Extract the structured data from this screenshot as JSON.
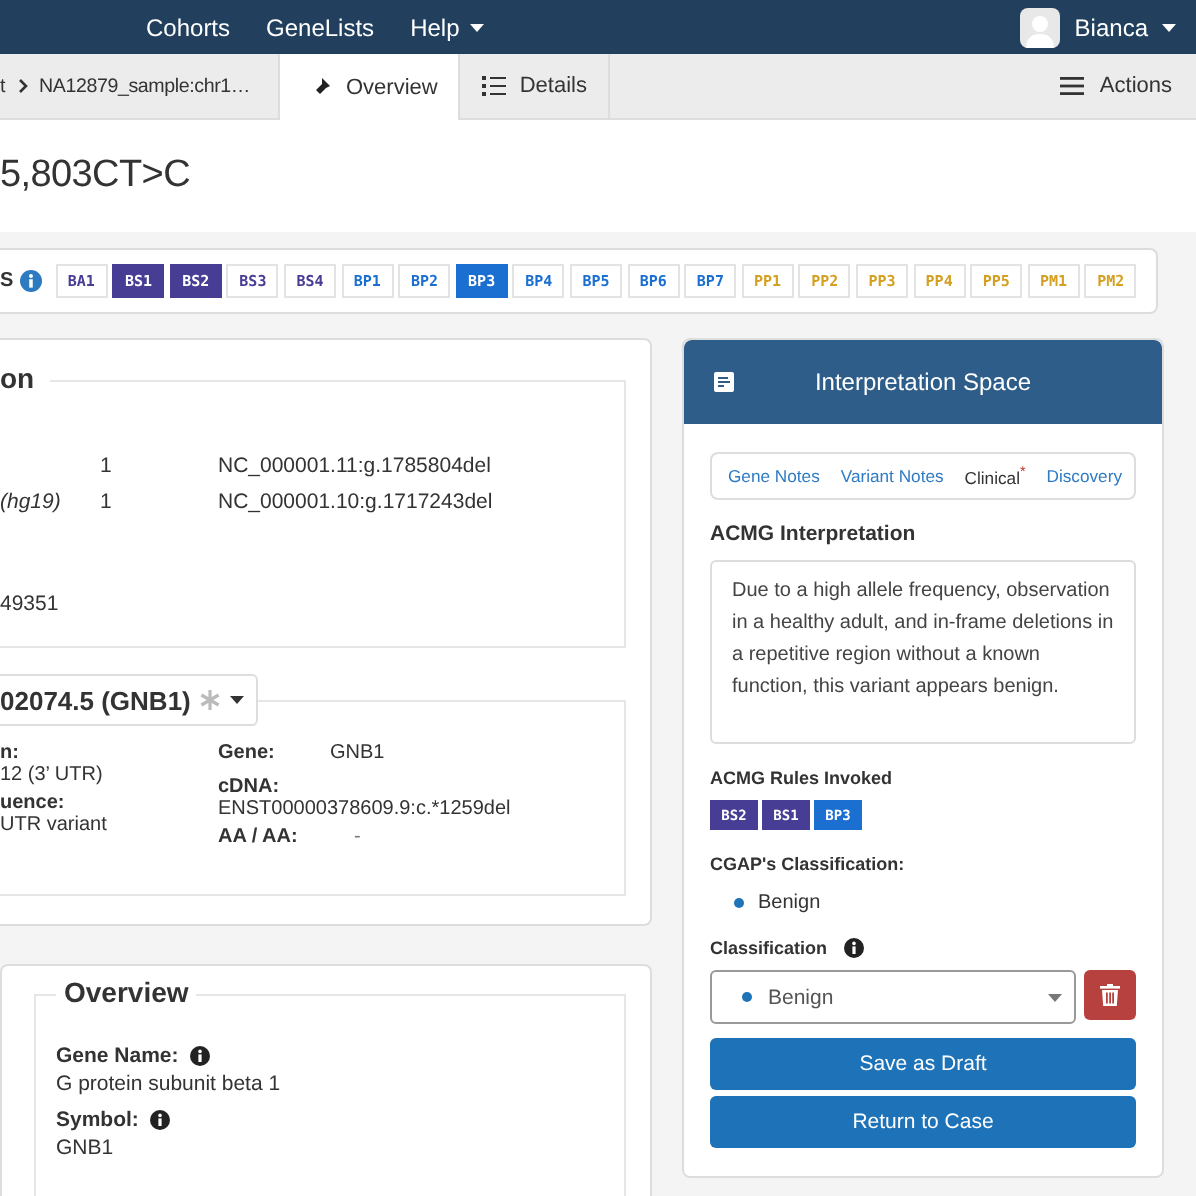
{
  "navbar": {
    "links": [
      {
        "label": "Cohorts",
        "dropdown": false
      },
      {
        "label": "GeneLists",
        "dropdown": false
      },
      {
        "label": "Help",
        "dropdown": true
      }
    ],
    "user": {
      "name": "Bianca",
      "dropdown": true
    }
  },
  "tabbar": {
    "breadcrumbs": [
      "t",
      "NA12879_sample:chr1…"
    ],
    "tabs": [
      {
        "label": "Overview",
        "selected": true
      },
      {
        "label": "Details",
        "selected": false
      }
    ],
    "actions": "Actions"
  },
  "title": "5,803CT>C",
  "acmg_rules": {
    "label": "S",
    "rules": [
      {
        "code": "BA1",
        "color": "#473d94",
        "selected": false
      },
      {
        "code": "BS1",
        "color": "#473d94",
        "selected": true
      },
      {
        "code": "BS2",
        "color": "#473d94",
        "selected": true
      },
      {
        "code": "BS3",
        "color": "#473d94",
        "selected": false
      },
      {
        "code": "BS4",
        "color": "#473d94",
        "selected": false
      },
      {
        "code": "BP1",
        "color": "#1a6fd0",
        "selected": false
      },
      {
        "code": "BP2",
        "color": "#1a6fd0",
        "selected": false
      },
      {
        "code": "BP3",
        "color": "#1a6fd0",
        "selected": true
      },
      {
        "code": "BP4",
        "color": "#1a6fd0",
        "selected": false
      },
      {
        "code": "BP5",
        "color": "#1a6fd0",
        "selected": false
      },
      {
        "code": "BP6",
        "color": "#1a6fd0",
        "selected": false
      },
      {
        "code": "BP7",
        "color": "#1a6fd0",
        "selected": false
      },
      {
        "code": "PP1",
        "color": "#d3a021",
        "selected": false
      },
      {
        "code": "PP2",
        "color": "#d3a021",
        "selected": false
      },
      {
        "code": "PP3",
        "color": "#d3a021",
        "selected": false
      },
      {
        "code": "PP4",
        "color": "#d3a021",
        "selected": false
      },
      {
        "code": "PP5",
        "color": "#d3a021",
        "selected": false
      },
      {
        "code": "PM1",
        "color": "#d3a021",
        "selected": false
      },
      {
        "code": "PM2",
        "color": "#d3a021",
        "selected": false
      }
    ]
  },
  "variant_info": {
    "legend": "on",
    "rows": [
      {
        "chromosome": "1",
        "notation": "NC_000001.11:g.1785804del"
      },
      {
        "label": "(hg19)",
        "chromosome": "1",
        "notation": "NC_000001.10:g.1717243del"
      }
    ],
    "identifier": "49351"
  },
  "transcript": {
    "name": "02074.5 (GNB1)",
    "columns": [
      [
        {
          "label": "n:",
          "value": "12 (3’ UTR)",
          "kind": "stacked"
        },
        {
          "label": "uence:",
          "value": "UTR variant",
          "kind": "stacked"
        }
      ],
      [
        {
          "label": "Gene:",
          "value": "GNB1",
          "kind": "inline"
        },
        {
          "label": "cDNA:",
          "value": "ENST00000378609.9:c.*1259del",
          "kind": "stacked"
        },
        {
          "label": "AA / AA:",
          "value": "-",
          "kind": "inline"
        }
      ]
    ]
  },
  "gene_overview": {
    "legend": "Overview",
    "fields": [
      {
        "label": "Gene Name:",
        "value": "G protein subunit beta 1"
      },
      {
        "label": "Symbol:",
        "value": "GNB1"
      }
    ]
  },
  "interpretation": {
    "title": "Interpretation Space",
    "tabs": [
      {
        "label": "Gene Notes",
        "required": false,
        "selected": false
      },
      {
        "label": "Variant Notes",
        "required": false,
        "selected": false
      },
      {
        "label": "Clinical",
        "required": true,
        "selected": true
      },
      {
        "label": "Discovery",
        "required": false,
        "selected": false
      }
    ],
    "required_mark": "*",
    "heading": "ACMG Interpretation",
    "text": "Due to a high allele frequency, observation in a healthy adult, and in-frame deletions in a repetitive region without a known function, this variant appears benign.",
    "rules_heading": "ACMG Rules Invoked",
    "rules": [
      {
        "code": "BS2",
        "color": "#473d94"
      },
      {
        "code": "BS1",
        "color": "#473d94"
      },
      {
        "code": "BP3",
        "color": "#1a6fd0"
      }
    ],
    "cgap_heading": "CGAP's Classification:",
    "cgap_value": {
      "label": "Benign",
      "color": "#1f73b8"
    },
    "classification_label": "Classification",
    "classification": {
      "label": "Benign",
      "color": "#1f73b8"
    },
    "buttons": [
      "Save as Draft",
      "Return to Case"
    ]
  }
}
